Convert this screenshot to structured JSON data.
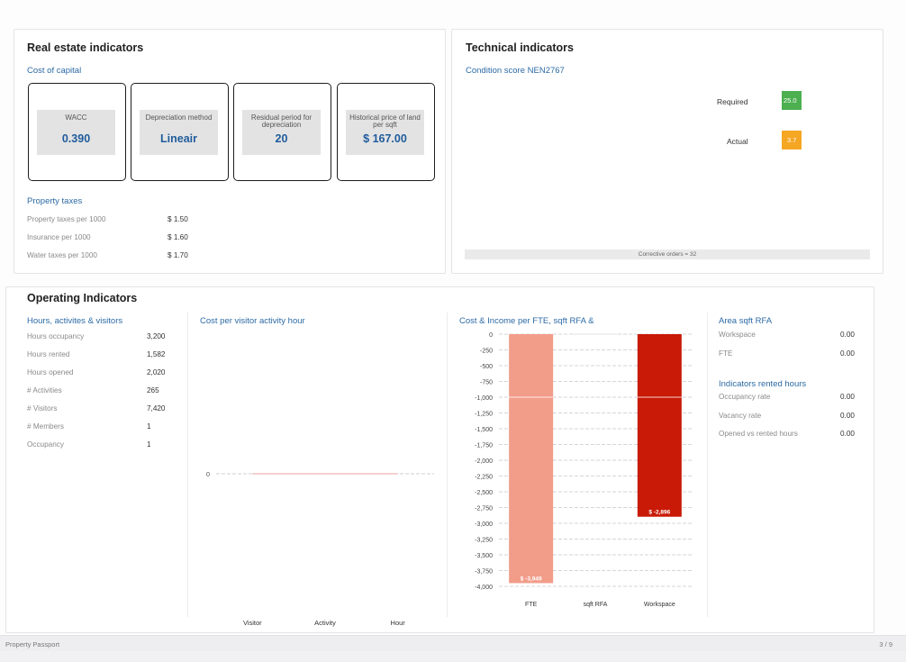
{
  "real_estate": {
    "title": "Real estate indicators",
    "cost_of_capital_label": "Cost of capital",
    "cards": [
      {
        "label": "WACC",
        "value": "0.390"
      },
      {
        "label": "Depreciation method",
        "value": "Lineair"
      },
      {
        "label": "Residual period for depreciation",
        "value": "20"
      },
      {
        "label": "Historical price of land per sqft",
        "value": "$ 167.00"
      }
    ],
    "property_taxes_label": "Property taxes",
    "taxes": [
      {
        "label": "Property taxes per 1000",
        "value": "$ 1.50"
      },
      {
        "label": "Insurance per 1000",
        "value": "$ 1.60"
      },
      {
        "label": "Water taxes per 1000",
        "value": "$ 1.70"
      }
    ]
  },
  "technical": {
    "title": "Technical indicators",
    "condition_label": "Condition score NEN2767",
    "required_label": "Required",
    "required_value": "25.0",
    "required_color": "#4caf50",
    "actual_label": "Actual",
    "actual_value": "3.7",
    "actual_color": "#f5a623",
    "corrective_orders": "Corrective orders =  32"
  },
  "operating": {
    "title": "Operating Indicators",
    "hours_label": "Hours, activites & visitors",
    "hours": [
      {
        "label": "Hours occupancy",
        "value": "3,200"
      },
      {
        "label": "Hours rented",
        "value": "1,582"
      },
      {
        "label": "Hours opened",
        "value": "2,020"
      },
      {
        "label": "# Activities",
        "value": "265"
      },
      {
        "label": "# Visitors",
        "value": "7,420"
      },
      {
        "label": "# Members",
        "value": "1"
      },
      {
        "label": "Occupancy",
        "value": "1"
      }
    ],
    "area_label": "Area sqft RFA",
    "area": [
      {
        "label": "Workspace",
        "value": "0.00"
      },
      {
        "label": "FTE",
        "value": "0.00"
      }
    ],
    "rented_label": "Indicators rented hours",
    "rented": [
      {
        "label": "Occupancy rate",
        "value": "0.00"
      },
      {
        "label": "Vacancy rate",
        "value": "0.00"
      },
      {
        "label": "Opened vs rented hours",
        "value": "0.00"
      }
    ]
  },
  "footer": {
    "left": "Property Passport",
    "right": "3 / 9"
  },
  "chart_data": [
    {
      "type": "line",
      "title": "Cost per visitor activity hour",
      "categories": [
        "Visitor",
        "Activity",
        "Hour"
      ],
      "values": [
        0,
        0,
        0
      ],
      "yticks": [
        "0"
      ],
      "ylim": [
        0,
        0
      ],
      "line_color": "#e8a0a0"
    },
    {
      "type": "bar",
      "title": "Cost & Income per FTE, sqft RFA &",
      "categories": [
        "FTE",
        "sqft RFA",
        "Workspace"
      ],
      "values": [
        -3949,
        0,
        -2896
      ],
      "data_labels": [
        "$ -3,949",
        "",
        "$ -2,896"
      ],
      "colors": [
        "#f29c8a",
        "#e0e0e0",
        "#c81a06"
      ],
      "ylim": [
        -4000,
        0
      ],
      "yticks": [
        "0",
        "-250",
        "-500",
        "-750",
        "-1,000",
        "-1,250",
        "-1,500",
        "-1,750",
        "-2,000",
        "-2,250",
        "-2,500",
        "-2,750",
        "-3,000",
        "-3,250",
        "-3,500",
        "-3,750",
        "-4,000"
      ],
      "grid": true
    }
  ]
}
